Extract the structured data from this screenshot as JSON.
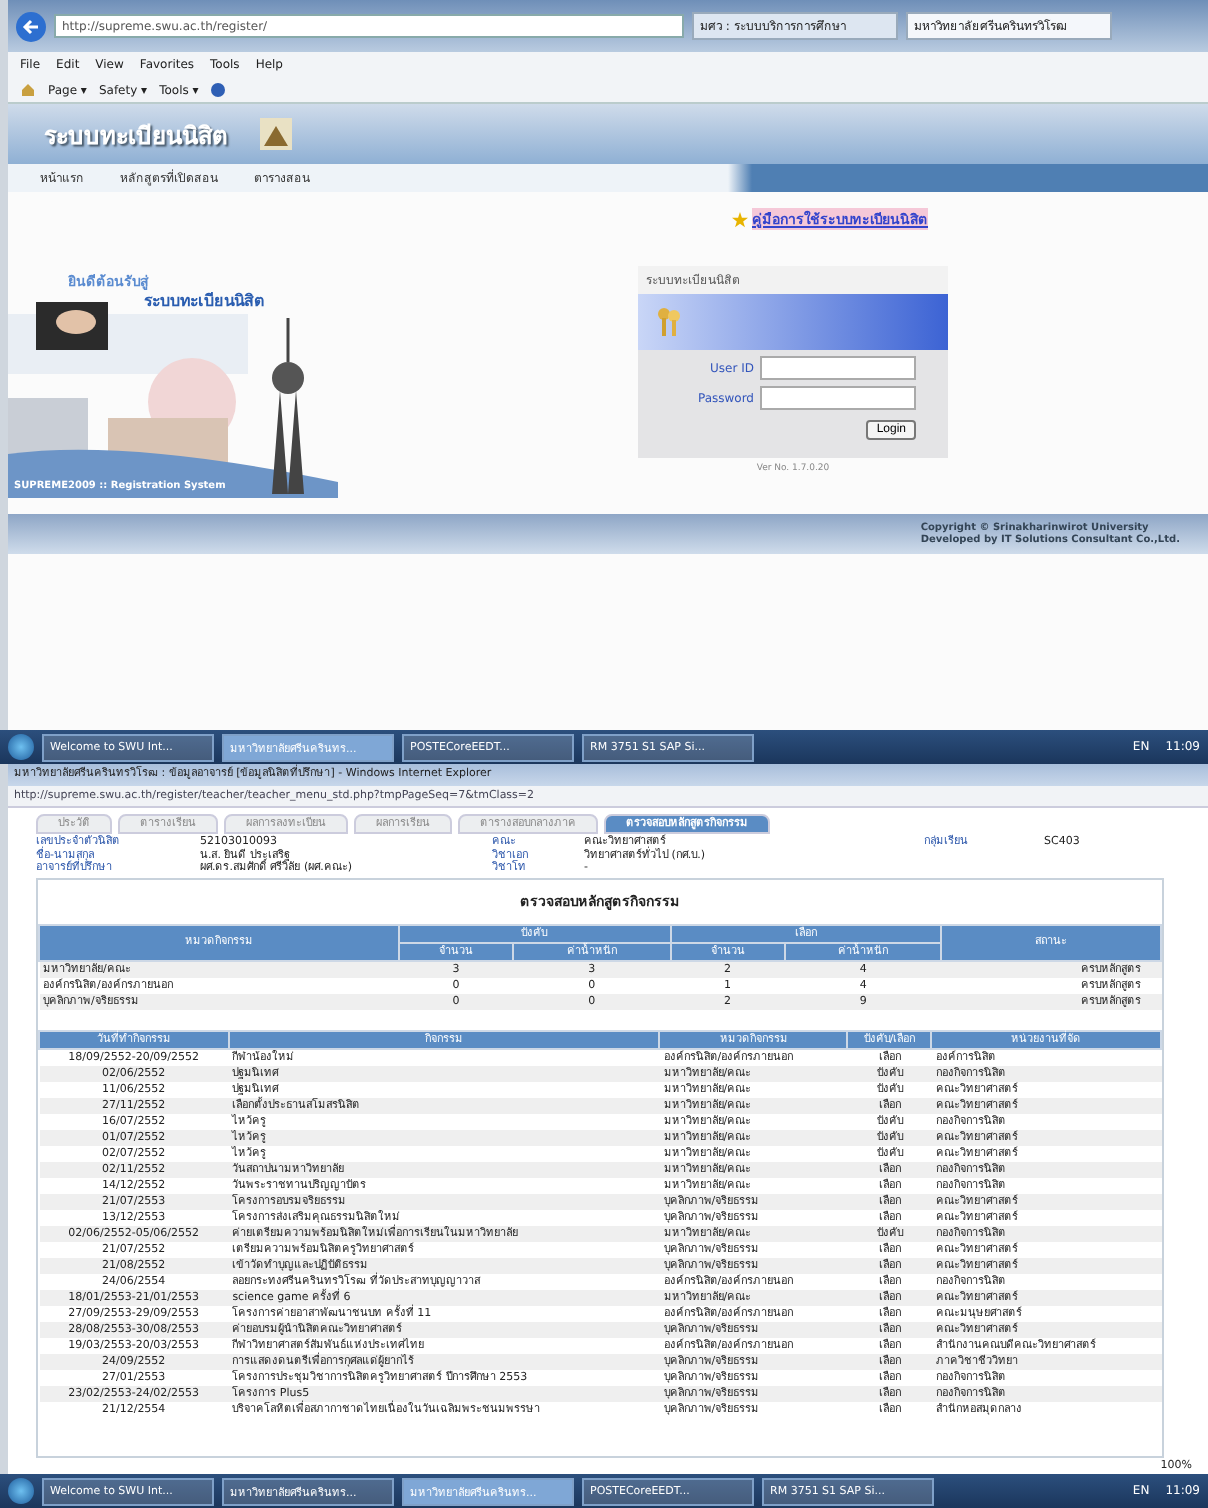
{
  "browser_1": {
    "address": "http://supreme.swu.ac.th/register/",
    "tabs": [
      {
        "label": "มศว : ระบบบริการการศึกษา",
        "selected": false
      },
      {
        "label": "มหาวิทยาลัยศรีนครินทรวิโรฒ",
        "selected": true
      }
    ],
    "menu": [
      "File",
      "Edit",
      "View",
      "Favorites",
      "Tools",
      "Help"
    ],
    "toolbar": [
      "Page ▾",
      "Safety ▾",
      "Tools ▾"
    ]
  },
  "site": {
    "title": "ระบบทะเบียนนิสิต",
    "nav": [
      "หน้าแรก",
      "หลักสูตรที่เปิดสอน",
      "ตารางสอน"
    ],
    "manual_link": "คู่มือการใช้ระบบทะเบียนนิสิต",
    "banner_greeting": "ยินดีต้อนรับสู่",
    "banner_title": "ระบบทะเบียนนิสิต",
    "banner_caption": "SUPREME2009 :: Registration System",
    "login": {
      "title": "ระบบทะเบียนนิสิต",
      "user_label": "User ID",
      "password_label": "Password",
      "button": "Login",
      "version": "Ver No. 1.7.0.20"
    },
    "footer": [
      "Copyright © Srinakharinwirot University",
      "Developed by IT Solutions Consultant Co.,Ltd."
    ]
  },
  "taskbar_1": {
    "tasks": [
      {
        "label": "Welcome to SWU Int...",
        "selected": false
      },
      {
        "label": "มหาวิทยาลัยศรีนครินทร...",
        "selected": true
      },
      {
        "label": "POSTECoreEEDT...",
        "selected": false
      },
      {
        "label": "RM 3751 S1 SAP Si...",
        "selected": false
      }
    ],
    "language": "EN",
    "clock": "11:09"
  },
  "window_2": {
    "title": "มหาวิทยาลัยศรีนครินทรวิโรฒ : ข้อมูลอาจารย์ [ข้อมูลนิสิตที่ปรึกษา] - Windows Internet Explorer",
    "address": "http://supreme.swu.ac.th/register/teacher/teacher_menu_std.php?tmpPageSeq=7&tmClass=2",
    "tabs": [
      {
        "label": "ประวัติ",
        "selected": false
      },
      {
        "label": "ตารางเรียน",
        "selected": false
      },
      {
        "label": "ผลการลงทะเบียน",
        "selected": false
      },
      {
        "label": "ผลการเรียน",
        "selected": false
      },
      {
        "label": "ตารางสอบกลางภาค",
        "selected": false
      },
      {
        "label": "ตรวจสอบหลักสูตรกิจกรรม",
        "selected": true
      }
    ],
    "info": [
      {
        "label": "เลขประจำตัวนิสิต",
        "value": "52103010093"
      },
      {
        "label": "คณะ",
        "value": "คณะวิทยาศาสตร์"
      },
      {
        "label": "กลุ่มเรียน",
        "value": "SC403"
      },
      {
        "label": "ชื่อ-นามสกุล",
        "value": "น.ส. ยินดี ประเสริฐ"
      },
      {
        "label": "วิชาเอก",
        "value": "วิทยาศาสตร์ทั่วไป (กศ.บ.)"
      },
      {
        "label": "อาจารย์ที่ปรึกษา",
        "value": "ผศ.ดร.สมศักดิ์ ศรีวิลัย (ผศ.คณะ)"
      },
      {
        "label": "วิชาโท",
        "value": "-"
      }
    ],
    "heading": "ตรวจสอบหลักสูตรกิจกรรม",
    "summary": {
      "header_rows": [
        [
          {
            "label": "หมวดกิจกรรม",
            "rowspan": 2
          },
          {
            "label": "บังคับ",
            "colspan": 2
          },
          {
            "label": "เลือก",
            "colspan": 2
          },
          {
            "label": "สถานะ",
            "rowspan": 2
          }
        ],
        [
          {
            "label": "จำนวน"
          },
          {
            "label": "ค่าน้ำหนัก"
          },
          {
            "label": "จำนวน"
          },
          {
            "label": "ค่าน้ำหนัก"
          }
        ]
      ],
      "rows": [
        [
          "มหาวิทยาลัย/คณะ",
          "3",
          "3",
          "2",
          "4",
          "ครบหลักสูตร"
        ],
        [
          "องค์กรนิสิต/องค์กรภายนอก",
          "0",
          "0",
          "1",
          "4",
          "ครบหลักสูตร"
        ],
        [
          "บุคลิกภาพ/จริยธรรม",
          "0",
          "0",
          "2",
          "9",
          "ครบหลักสูตร"
        ]
      ]
    },
    "activities": {
      "columns": [
        "วันที่ทำกิจกรรม",
        "กิจกรรม",
        "หมวดกิจกรรม",
        "บังคับ/เลือก",
        "หน่วยงานที่จัด"
      ],
      "rows": [
        [
          "18/09/2552-20/09/2552",
          "กีฬาน้องใหม่",
          "องค์กรนิสิต/องค์กรภายนอก",
          "เลือก",
          "องค์การนิสิต"
        ],
        [
          "02/06/2552",
          "ปฐมนิเทศ",
          "มหาวิทยาลัย/คณะ",
          "บังคับ",
          "กองกิจการนิสิต"
        ],
        [
          "11/06/2552",
          "ปฐมนิเทศ",
          "มหาวิทยาลัย/คณะ",
          "บังคับ",
          "คณะวิทยาศาสตร์"
        ],
        [
          "27/11/2552",
          "เลือกตั้งประธานสโมสรนิสิต",
          "มหาวิทยาลัย/คณะ",
          "เลือก",
          "คณะวิทยาศาสตร์"
        ],
        [
          "16/07/2552",
          "ไหว้ครู",
          "มหาวิทยาลัย/คณะ",
          "บังคับ",
          "กองกิจการนิสิต"
        ],
        [
          "01/07/2552",
          "ไหว้ครู",
          "มหาวิทยาลัย/คณะ",
          "บังคับ",
          "คณะวิทยาศาสตร์"
        ],
        [
          "02/07/2552",
          "ไหว้ครู",
          "มหาวิทยาลัย/คณะ",
          "บังคับ",
          "คณะวิทยาศาสตร์"
        ],
        [
          "02/11/2552",
          "วันสถาปนามหาวิทยาลัย",
          "มหาวิทยาลัย/คณะ",
          "เลือก",
          "กองกิจการนิสิต"
        ],
        [
          "14/12/2552",
          "วันพระราชทานปริญญาบัตร",
          "มหาวิทยาลัย/คณะ",
          "เลือก",
          "กองกิจการนิสิต"
        ],
        [
          "21/07/2553",
          "โครงการอบรมจริยธรรม",
          "บุคลิกภาพ/จริยธรรม",
          "เลือก",
          "คณะวิทยาศาสตร์"
        ],
        [
          "13/12/2553",
          "โครงการส่งเสริมคุณธรรมนิสิตใหม่",
          "บุคลิกภาพ/จริยธรรม",
          "เลือก",
          "คณะวิทยาศาสตร์"
        ],
        [
          "02/06/2552-05/06/2552",
          "ค่ายเตรียมความพร้อมนิสิตใหม่เพื่อการเรียนในมหาวิทยาลัย",
          "มหาวิทยาลัย/คณะ",
          "บังคับ",
          "กองกิจการนิสิต"
        ],
        [
          "21/07/2552",
          "เตรียมความพร้อมนิสิตครูวิทยาศาสตร์",
          "บุคลิกภาพ/จริยธรรม",
          "เลือก",
          "คณะวิทยาศาสตร์"
        ],
        [
          "21/08/2552",
          "เข้าวัดทำบุญและปฏิบัติธรรม",
          "บุคลิกภาพ/จริยธรรม",
          "เลือก",
          "คณะวิทยาศาสตร์"
        ],
        [
          "24/06/2554",
          "ลอยกระทงศรีนครินทรวิโรฒ ที่วัดประสาทบุญญาวาส",
          "องค์กรนิสิต/องค์กรภายนอก",
          "เลือก",
          "กองกิจการนิสิต"
        ],
        [
          "18/01/2553-21/01/2553",
          "science game ครั้งที่ 6",
          "มหาวิทยาลัย/คณะ",
          "เลือก",
          "คณะวิทยาศาสตร์"
        ],
        [
          "27/09/2553-29/09/2553",
          "โครงการค่ายอาสาพัฒนาชนบท ครั้งที่ 11",
          "องค์กรนิสิต/องค์กรภายนอก",
          "เลือก",
          "คณะมนุษยศาสตร์"
        ],
        [
          "28/08/2553-30/08/2553",
          "ค่ายอบรมผู้นำนิสิตคณะวิทยาศาสตร์",
          "บุคลิกภาพ/จริยธรรม",
          "เลือก",
          "คณะวิทยาศาสตร์"
        ],
        [
          "19/03/2553-20/03/2553",
          "กีฬาวิทยาศาสตร์สัมพันธ์แห่งประเทศไทย",
          "องค์กรนิสิต/องค์กรภายนอก",
          "เลือก",
          "สำนักงานคณบดีคณะวิทยาศาสตร์"
        ],
        [
          "24/09/2552",
          "การแสดงดนตรีเพื่อการกุศลแด่ผู้ยากไร้",
          "บุคลิกภาพ/จริยธรรม",
          "เลือก",
          "ภาควิชาชีววิทยา"
        ],
        [
          "27/01/2553",
          "โครงการประชุมวิชาการนิสิตครูวิทยาศาสตร์ ปีการศึกษา 2553",
          "บุคลิกภาพ/จริยธรรม",
          "เลือก",
          "กองกิจการนิสิต"
        ],
        [
          "23/02/2553-24/02/2553",
          "โครงการ Plus5",
          "บุคลิกภาพ/จริยธรรม",
          "เลือก",
          "กองกิจการนิสิต"
        ],
        [
          "21/12/2554",
          "บริจาคโลหิตเพื่อสภากาชาดไทยเนื่องในวันเฉลิมพระชนมพรรษา",
          "บุคลิกภาพ/จริยธรรม",
          "เลือก",
          "สำนักหอสมุดกลาง"
        ]
      ]
    },
    "zoom": "100%"
  },
  "taskbar_2": {
    "tasks": [
      {
        "label": "Welcome to SWU Int...",
        "selected": false
      },
      {
        "label": "มหาวิทยาลัยศรีนครินทร...",
        "selected": false
      },
      {
        "label": "มหาวิทยาลัยศรีนครินทร...",
        "selected": true
      },
      {
        "label": "POSTECoreEEDT...",
        "selected": false
      },
      {
        "label": "RM 3751 S1 SAP Si...",
        "selected": false
      }
    ],
    "language": "EN",
    "clock": "11:09"
  }
}
